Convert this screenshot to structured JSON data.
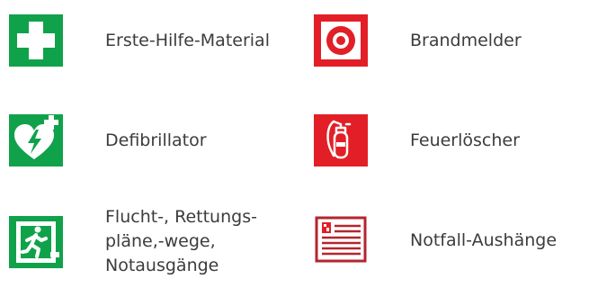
{
  "colors": {
    "green": "#10a24a",
    "red": "#e21f26",
    "white": "#ffffff",
    "text": "#3c3c3c"
  },
  "items": [
    {
      "label": "Erste-Hilfe-Material",
      "icon": "first-aid-cross-icon"
    },
    {
      "label": "Brandmelder",
      "icon": "fire-alarm-icon"
    },
    {
      "label": "Defibrillator",
      "icon": "defibrillator-heart-icon"
    },
    {
      "label": "Feuerlöscher",
      "icon": "fire-extinguisher-icon"
    },
    {
      "label": "Flucht-, Rettungs-\npläne,-wege,\nNotausgänge",
      "icon": "emergency-exit-icon"
    },
    {
      "label": "Notfall-Aushänge",
      "icon": "emergency-notice-icon"
    }
  ]
}
